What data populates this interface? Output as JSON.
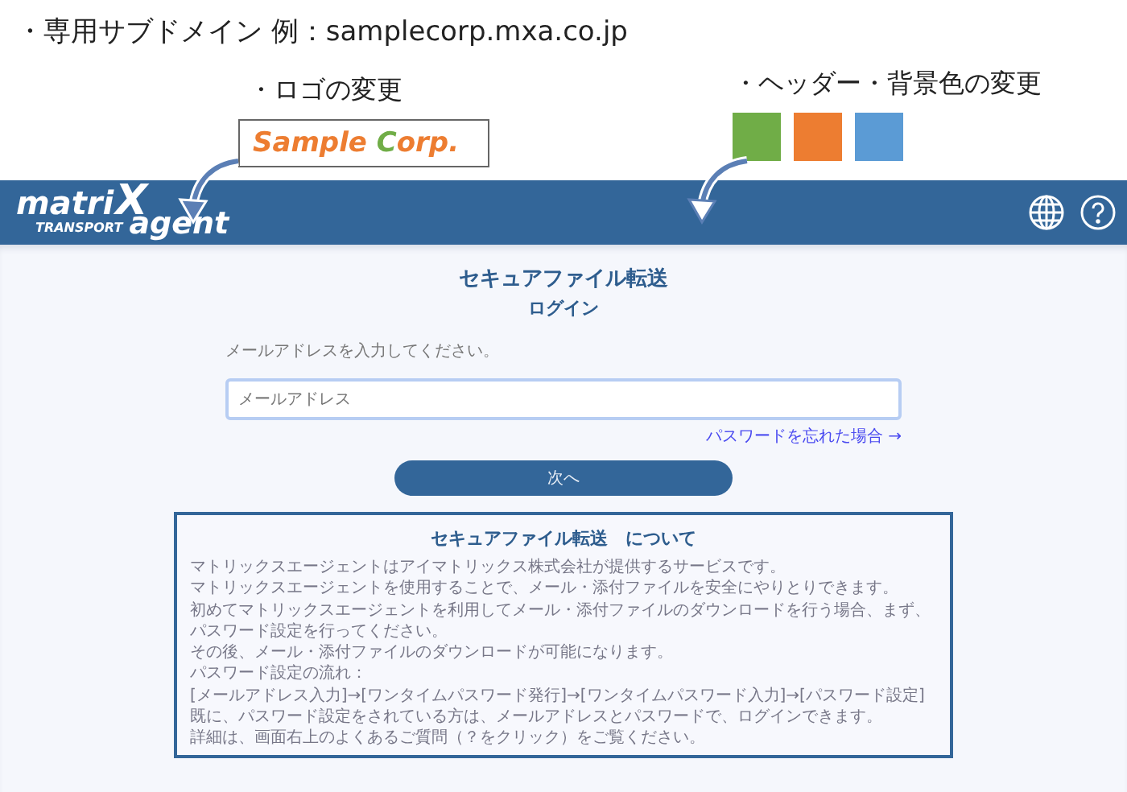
{
  "caption": "・専用サブドメイン 例：samplecorp.mxa.co.jp",
  "logo_note": {
    "label": "・ロゴの変更",
    "sample_logo": [
      {
        "text": "Sample ",
        "color": "#ed7d31"
      },
      {
        "text": "C",
        "color": "#70ad47"
      },
      {
        "text": "orp.",
        "color": "#ed7d31"
      }
    ]
  },
  "color_note": {
    "label": "・ヘッダー・背景色の変更",
    "swatches": [
      {
        "color": "#70ad47"
      },
      {
        "color": "#ed7d31"
      },
      {
        "color": "#5b9bd5"
      }
    ]
  },
  "header": {
    "logo": {
      "word_1": "matri",
      "mark": "X",
      "word_2": "agent",
      "sub": "TRANSPORT"
    }
  },
  "login": {
    "title": "セキュアファイル転送",
    "subtitle": "ログイン",
    "prompt": "メールアドレスを入力してください。",
    "email": {
      "placeholder": "メールアドレス"
    },
    "forgot_link": "パスワードを忘れた場合 →",
    "next_button": "次へ"
  },
  "about": {
    "title": "セキュアファイル転送　について",
    "lines": [
      "マトリックスエージェントはアイマトリックス株式会社が提供するサービスです。",
      "マトリックスエージェントを使用することで、メール・添付ファイルを安全にやりとりできます。",
      "初めてマトリックスエージェントを利用してメール・添付ファイルのダウンロードを行う場合、まず、パスワード設定を行ってください。",
      "その後、メール・添付ファイルのダウンロードが可能になります。",
      "パスワード設定の流れ：",
      "[メールアドレス入力]→[ワンタイムパスワード発行]→[ワンタイムパスワード入力]→[パスワード設定]",
      "既に、パスワード設定をされている方は、メールアドレスとパスワードで、ログインできます。",
      "詳細は、画面右上のよくあるご質問（？をクリック）をご覧ください。"
    ]
  }
}
